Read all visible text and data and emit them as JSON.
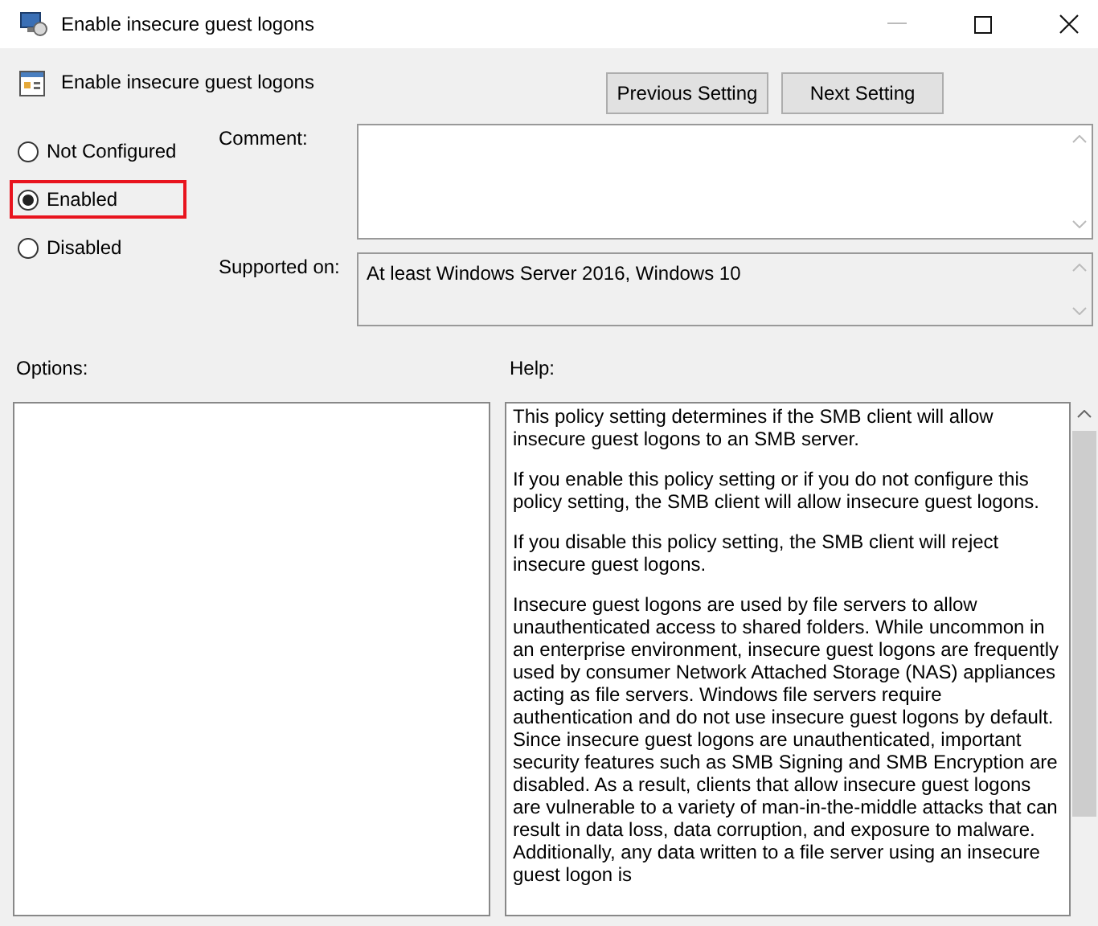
{
  "window": {
    "title": "Enable insecure guest logons"
  },
  "header": {
    "policy_name": "Enable insecure guest logons",
    "buttons": [
      "Previous Setting",
      "Next Setting"
    ]
  },
  "options_state": [
    {
      "label": "Not Configured",
      "selected": false,
      "highlighted": false
    },
    {
      "label": "Enabled",
      "selected": true,
      "highlighted": true
    },
    {
      "label": "Disabled",
      "selected": false,
      "highlighted": false
    }
  ],
  "comment": {
    "label": "Comment:"
  },
  "supported_on": {
    "label": "Supported on:",
    "value": "At least Windows Server 2016, Windows 10"
  },
  "options": {
    "label": "Options:"
  },
  "help": {
    "label": "Help:",
    "paragraphs": [
      "This policy setting determines if the SMB client will allow insecure guest logons to an SMB server.",
      "If you enable this policy setting or if you do not configure this policy setting, the SMB client will allow insecure guest logons.",
      "If you disable this policy setting, the SMB client will reject insecure guest logons.",
      "Insecure guest logons are used by file servers to allow unauthenticated access to shared folders. While uncommon in an enterprise environment, insecure guest logons are frequently used by consumer Network Attached Storage (NAS) appliances acting as file servers. Windows file servers require authentication and do not use insecure guest logons by default. Since insecure guest logons are unauthenticated, important security features such as SMB Signing and SMB Encryption are disabled. As a result, clients that allow insecure guest logons are vulnerable to a variety of man-in-the-middle attacks that can result in data loss, data corruption, and exposure to malware. Additionally, any data written to a file server using an insecure guest logon is"
    ]
  }
}
